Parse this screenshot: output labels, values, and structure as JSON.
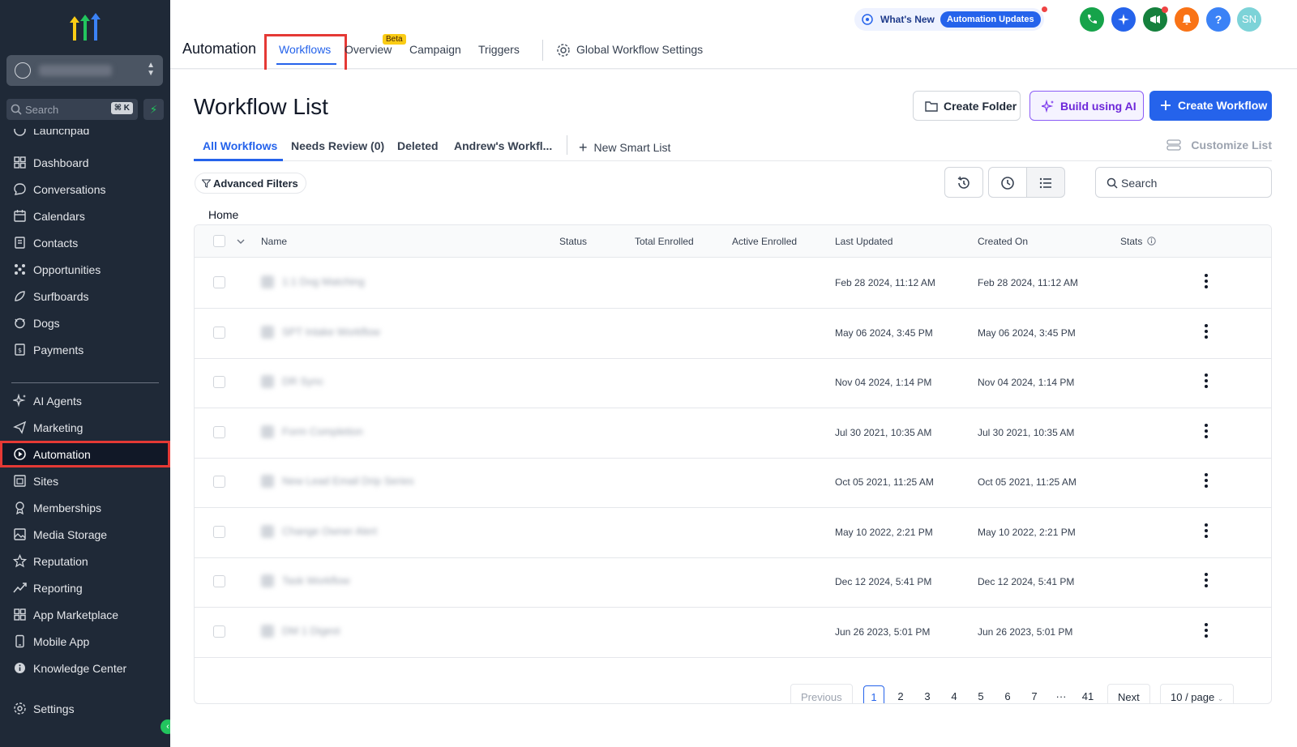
{
  "sidebar": {
    "search_placeholder": "Search",
    "search_shortcut": "⌘ K",
    "items": [
      {
        "label": "Launchpad",
        "icon": "launchpad-icon"
      },
      {
        "label": "Dashboard",
        "icon": "dashboard-icon"
      },
      {
        "label": "Conversations",
        "icon": "chat-icon"
      },
      {
        "label": "Calendars",
        "icon": "calendar-icon"
      },
      {
        "label": "Contacts",
        "icon": "contacts-icon"
      },
      {
        "label": "Opportunities",
        "icon": "opportunities-icon"
      },
      {
        "label": "Surfboards",
        "icon": "surfboard-icon"
      },
      {
        "label": "Dogs",
        "icon": "dog-icon"
      },
      {
        "label": "Payments",
        "icon": "payments-icon"
      },
      {
        "label": "AI Agents",
        "icon": "sparkle-icon"
      },
      {
        "label": "Marketing",
        "icon": "send-icon"
      },
      {
        "label": "Automation",
        "icon": "automation-icon"
      },
      {
        "label": "Sites",
        "icon": "sites-icon"
      },
      {
        "label": "Memberships",
        "icon": "membership-icon"
      },
      {
        "label": "Media Storage",
        "icon": "image-icon"
      },
      {
        "label": "Reputation",
        "icon": "star-icon"
      },
      {
        "label": "Reporting",
        "icon": "chart-line-icon"
      },
      {
        "label": "App Marketplace",
        "icon": "apps-grid-icon"
      },
      {
        "label": "Mobile App",
        "icon": "phone-icon"
      },
      {
        "label": "Knowledge Center",
        "icon": "info-icon"
      },
      {
        "label": "Settings",
        "icon": "gear-icon"
      }
    ]
  },
  "header": {
    "title": "Automation",
    "tabs": [
      "Workflows",
      "Overview",
      "Campaign",
      "Triggers"
    ],
    "beta_badge": "Beta",
    "global_settings": "Global Workflow Settings",
    "whats_new": "What's New",
    "updates_badge": "Automation Updates",
    "avatar_initials": "SN",
    "help_glyph": "?"
  },
  "page": {
    "title": "Workflow List",
    "buttons": {
      "create_folder": "Create Folder",
      "build_ai": "Build using AI",
      "create_workflow": "Create Workflow"
    },
    "subtabs": [
      "All Workflows",
      "Needs Review (0)",
      "Deleted",
      "Andrew's Workfl..."
    ],
    "new_smart_list": "New Smart List",
    "customize_list": "Customize List",
    "advanced_filters": "Advanced Filters",
    "search_placeholder": "Search",
    "breadcrumb": "Home"
  },
  "table": {
    "columns": [
      "Name",
      "Status",
      "Total Enrolled",
      "Active Enrolled",
      "Last Updated",
      "Created On",
      "Stats"
    ],
    "rows": [
      {
        "name": "1:1 Dog Matching",
        "last_updated": "Feb 28 2024, 11:12 AM",
        "created_on": "Feb 28 2024, 11:12 AM"
      },
      {
        "name": "SPT Intake Workflow",
        "last_updated": "May 06 2024, 3:45 PM",
        "created_on": "May 06 2024, 3:45 PM"
      },
      {
        "name": "DR Sync",
        "last_updated": "Nov 04 2024, 1:14 PM",
        "created_on": "Nov 04 2024, 1:14 PM"
      },
      {
        "name": "Form Completion",
        "last_updated": "Jul 30 2021, 10:35 AM",
        "created_on": "Jul 30 2021, 10:35 AM"
      },
      {
        "name": "New Lead Email Drip Series",
        "last_updated": "Oct 05 2021, 11:25 AM",
        "created_on": "Oct 05 2021, 11:25 AM"
      },
      {
        "name": "Change Owner Alert",
        "last_updated": "May 10 2022, 2:21 PM",
        "created_on": "May 10 2022, 2:21 PM"
      },
      {
        "name": "Task Workflow",
        "last_updated": "Dec 12 2024, 5:41 PM",
        "created_on": "Dec 12 2024, 5:41 PM"
      },
      {
        "name": "DM 1 Digest",
        "last_updated": "Jun 26 2023, 5:01 PM",
        "created_on": "Jun 26 2023, 5:01 PM"
      }
    ]
  },
  "pagination": {
    "previous": "Previous",
    "pages": [
      "1",
      "2",
      "3",
      "4",
      "5",
      "6",
      "7",
      "···",
      "41"
    ],
    "current": "1",
    "next": "Next",
    "per_page": "10 / page"
  },
  "colors": {
    "primary": "#2563eb",
    "sidebar": "#1f2937",
    "highlight": "#e53935",
    "ai_purple": "#6d28d9"
  }
}
